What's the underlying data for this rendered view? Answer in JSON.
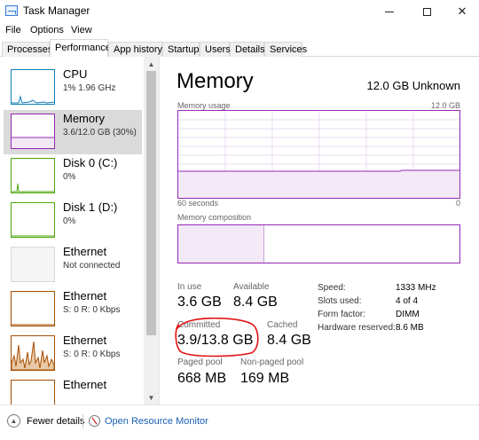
{
  "window": {
    "title": "Task Manager"
  },
  "menu": [
    "File",
    "Options",
    "View"
  ],
  "tabs": [
    "Processes",
    "Performance",
    "App history",
    "Startup",
    "Users",
    "Details",
    "Services"
  ],
  "sidebar": {
    "items": [
      {
        "name": "CPU",
        "sub": "1% 1.96 GHz",
        "selected": false
      },
      {
        "name": "Memory",
        "sub": "3.6/12.0 GB (30%)",
        "selected": true
      },
      {
        "name": "Disk 0 (C:)",
        "sub": "0%",
        "selected": false
      },
      {
        "name": "Disk 1 (D:)",
        "sub": "0%",
        "selected": false
      },
      {
        "name": "Ethernet",
        "sub": "Not connected",
        "selected": false
      },
      {
        "name": "Ethernet",
        "sub": "S: 0 R: 0 Kbps",
        "selected": false
      },
      {
        "name": "Ethernet",
        "sub": "S: 0 R: 0 Kbps",
        "selected": false
      },
      {
        "name": "Ethernet",
        "sub": "",
        "selected": false
      }
    ]
  },
  "memory": {
    "title": "Memory",
    "total": "12.0 GB Unknown",
    "usage_label": "Memory usage",
    "usage_max": "12.0 GB",
    "axis_left": "60 seconds",
    "axis_right": "0",
    "composition_label": "Memory composition",
    "in_use_label": "In use",
    "in_use_value": "3.6 GB",
    "available_label": "Available",
    "available_value": "8.4 GB",
    "committed_label": "Committed",
    "committed_value": "3.9/13.8 GB",
    "cached_label": "Cached",
    "cached_value": "8.4 GB",
    "paged_label": "Paged pool",
    "paged_value": "668 MB",
    "nonpaged_label": "Non-paged pool",
    "nonpaged_value": "169 MB",
    "info": [
      {
        "label": "Speed:",
        "value": "1333 MHz"
      },
      {
        "label": "Slots used:",
        "value": "4 of 4"
      },
      {
        "label": "Form factor:",
        "value": "DIMM"
      },
      {
        "label": "Hardware reserved:",
        "value": "8.6 MB"
      }
    ]
  },
  "footer": {
    "fewer_details": "Fewer details",
    "open_monitor": "Open Resource Monitor"
  },
  "colors": {
    "memory_accent": "#9528b4",
    "cpu_accent": "#117dbb",
    "disk_accent": "#4da60c",
    "ethernet_accent": "#a74f01",
    "annotation": "#e01010"
  }
}
